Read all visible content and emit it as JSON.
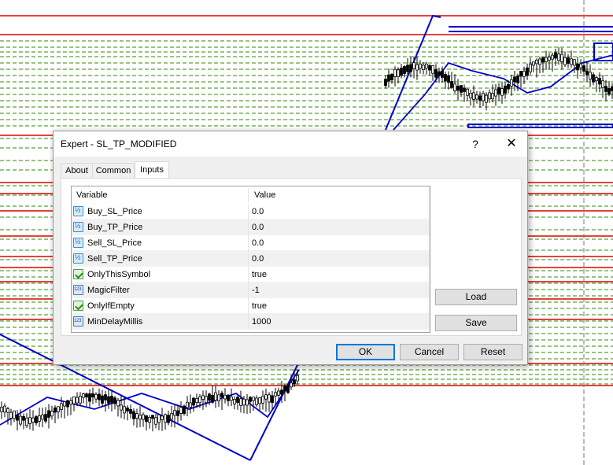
{
  "dialog": {
    "title": "Expert - SL_TP_MODIFIED",
    "help_label": "?",
    "close_label": "✕"
  },
  "tabs": [
    {
      "label": "About"
    },
    {
      "label": "Common"
    },
    {
      "label": "Inputs",
      "active": true
    }
  ],
  "grid": {
    "col_variable": "Variable",
    "col_value": "Value",
    "rows": [
      {
        "icon": "double-type-icon",
        "variable": "Buy_SL_Price",
        "value": "0.0"
      },
      {
        "icon": "double-type-icon",
        "variable": "Buy_TP_Price",
        "value": "0.0"
      },
      {
        "icon": "double-type-icon",
        "variable": "Sell_SL_Price",
        "value": "0.0"
      },
      {
        "icon": "double-type-icon",
        "variable": "Sell_TP_Price",
        "value": "0.0"
      },
      {
        "icon": "bool-type-icon",
        "variable": "OnlyThisSymbol",
        "value": "true"
      },
      {
        "icon": "int-type-icon",
        "variable": "MagicFilter",
        "value": "-1"
      },
      {
        "icon": "bool-type-icon",
        "variable": "OnlyIfEmpty",
        "value": "true"
      },
      {
        "icon": "int-type-icon",
        "variable": "MinDelayMillis",
        "value": "1000"
      }
    ]
  },
  "side_buttons": {
    "load": "Load",
    "save": "Save"
  },
  "footer": {
    "ok": "OK",
    "cancel": "Cancel",
    "reset": "Reset"
  },
  "colors": {
    "level_red": "#e00000",
    "level_green_dash": "#2e8b00",
    "trend_blue": "#0000cc",
    "accent": "#0078d7"
  }
}
